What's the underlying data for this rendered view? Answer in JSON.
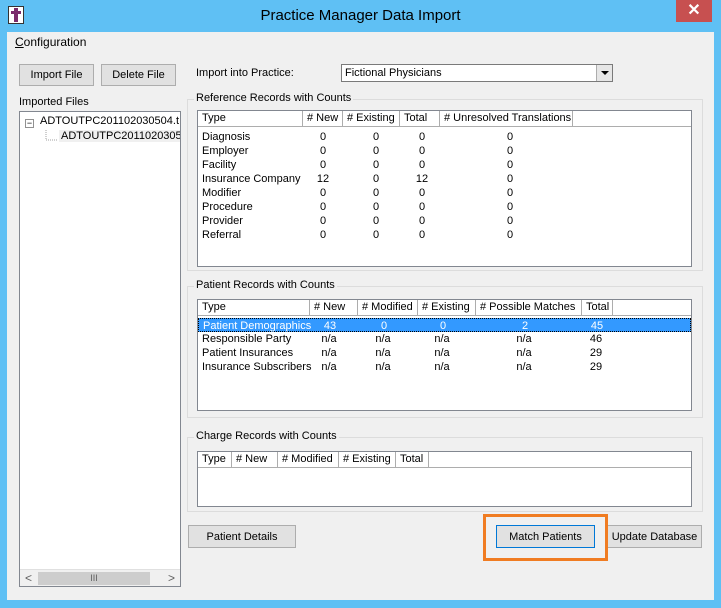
{
  "window": {
    "title": "Practice Manager Data Import",
    "close_glyph": "✕"
  },
  "menu": {
    "configuration_mnemonic": "C",
    "configuration_rest": "onfiguration"
  },
  "buttons": {
    "import_file": "Import File",
    "delete_file": "Delete File",
    "patient_details": "Patient Details",
    "match_patients": "Match Patients",
    "update_database": "Update Database"
  },
  "imported_files": {
    "label": "Imported Files",
    "root": "ADTOUTPC201102030504.t",
    "child": "ADTOUTPC2011020305",
    "toggle_glyph": "−",
    "scroll_left": "<",
    "scroll_right": ">",
    "scroll_grip": "III"
  },
  "import_into": {
    "label": "Import into Practice:",
    "value": "Fictional Physicians"
  },
  "reference_records": {
    "title": "Reference Records with Counts",
    "headers": [
      "Type",
      "# New",
      "# Existing",
      "Total",
      "# Unresolved Translations"
    ],
    "rows": [
      [
        "Diagnosis",
        "0",
        "0",
        "0",
        "0"
      ],
      [
        "Employer",
        "0",
        "0",
        "0",
        "0"
      ],
      [
        "Facility",
        "0",
        "0",
        "0",
        "0"
      ],
      [
        "Insurance Company",
        "12",
        "0",
        "12",
        "0"
      ],
      [
        "Modifier",
        "0",
        "0",
        "0",
        "0"
      ],
      [
        "Procedure",
        "0",
        "0",
        "0",
        "0"
      ],
      [
        "Provider",
        "0",
        "0",
        "0",
        "0"
      ],
      [
        "Referral",
        "0",
        "0",
        "0",
        "0"
      ]
    ]
  },
  "patient_records": {
    "title": "Patient Records with Counts",
    "headers": [
      "Type",
      "# New",
      "# Modified",
      "# Existing",
      "# Possible Matches",
      "Total"
    ],
    "rows": [
      [
        "Patient Demographics",
        "43",
        "0",
        "0",
        "2",
        "45"
      ],
      [
        "Responsible Party",
        "n/a",
        "n/a",
        "n/a",
        "n/a",
        "46"
      ],
      [
        "Patient Insurances",
        "n/a",
        "n/a",
        "n/a",
        "n/a",
        "29"
      ],
      [
        "Insurance Subscribers",
        "n/a",
        "n/a",
        "n/a",
        "n/a",
        "29"
      ]
    ],
    "selected_row": 0
  },
  "charge_records": {
    "title": "Charge Records with Counts",
    "headers": [
      "Type",
      "# New",
      "# Modified",
      "# Existing",
      "Total"
    ]
  },
  "colors": {
    "titlebar": "#5fc0f4",
    "selection": "#3399ff",
    "highlight": "#f07c22",
    "close": "#c75050"
  }
}
